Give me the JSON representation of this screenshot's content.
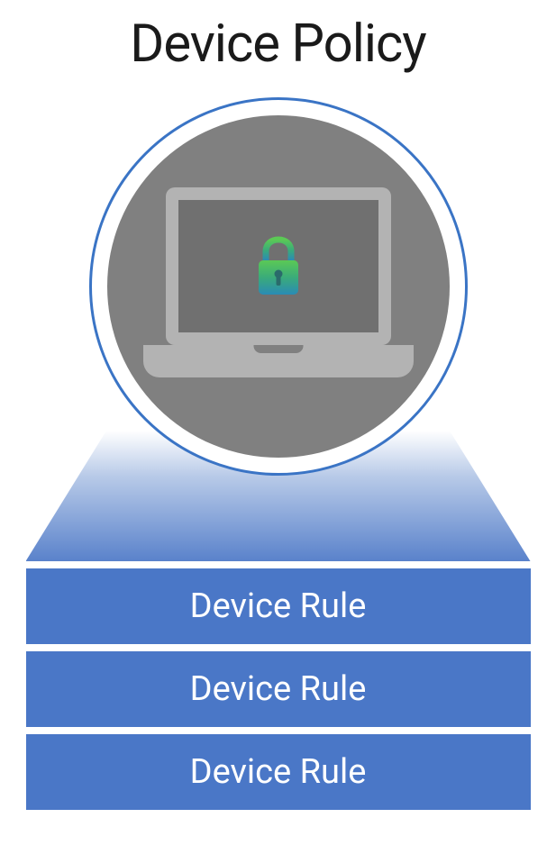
{
  "title": "Device Policy",
  "icon_semantic": "laptop-with-lock-icon",
  "rules": [
    {
      "label": "Device Rule"
    },
    {
      "label": "Device Rule"
    },
    {
      "label": "Device Rule"
    }
  ],
  "colors": {
    "rule_bg": "#4a77c7",
    "circle_border": "#3a74c5",
    "circle_fill": "#808080"
  }
}
